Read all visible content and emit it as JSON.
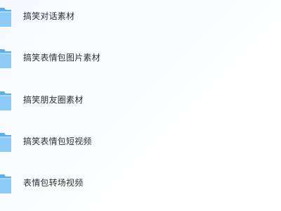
{
  "folders": [
    {
      "label": "搞笑对话素材",
      "icon": "folder-icon"
    },
    {
      "label": "搞笑表情包图片素材",
      "icon": "folder-icon"
    },
    {
      "label": "搞笑朋友圈素材",
      "icon": "folder-icon"
    },
    {
      "label": "搞笑表情包短视频",
      "icon": "folder-icon"
    },
    {
      "label": "表情包转场视频",
      "icon": "folder-icon"
    }
  ],
  "colors": {
    "folder_back": "#5aaef0",
    "folder_front": "#8ccaf7",
    "text": "#2b3038"
  }
}
